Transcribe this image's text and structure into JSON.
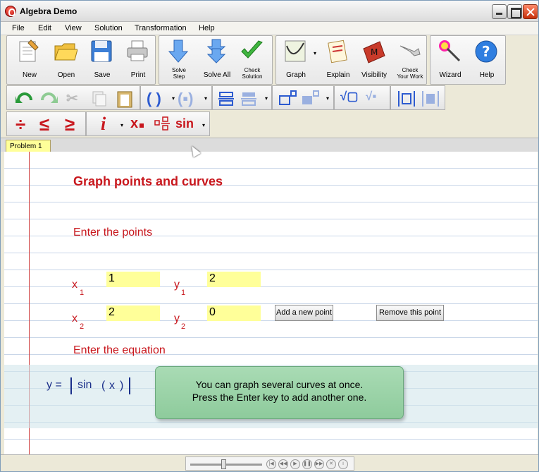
{
  "window": {
    "title": "Algebra Demo"
  },
  "menu": [
    "File",
    "Edit",
    "View",
    "Solution",
    "Transformation",
    "Help"
  ],
  "toolbar": {
    "new": "New",
    "open": "Open",
    "save": "Save",
    "print": "Print",
    "solve_step": "Solve\nStep",
    "solve_all": "Solve All",
    "check_solution": "Check\nSolution",
    "graph": "Graph",
    "explain": "Explain",
    "visibility": "Visibility",
    "check_work": "Check\nYour Work",
    "wizard": "Wizard",
    "help": "Help"
  },
  "format_toolbar": {
    "divide": "÷",
    "less_equal": "≤",
    "greater_equal": "≥",
    "info": "i",
    "subscript_x": "x",
    "sin": "sin"
  },
  "tabs": {
    "problem": "Problem 1"
  },
  "content": {
    "title": "Graph points and curves",
    "points_heading": "Enter the points",
    "equation_heading": "Enter the equation",
    "point1": {
      "x_label": "x",
      "x_sub": "1",
      "x_value": "1",
      "y_label": "y",
      "y_sub": "1",
      "y_value": "2"
    },
    "point2": {
      "x_label": "x",
      "x_sub": "2",
      "x_value": "2",
      "y_label": "y",
      "y_sub": "2",
      "y_value": "0"
    },
    "add_point_button": "Add a new point",
    "remove_point_button": "Remove this point",
    "equation": {
      "lhs": "y =",
      "func": "sin",
      "open_paren": "(",
      "arg": "x",
      "close_paren": ")"
    },
    "tooltip_line1": "You can graph several curves at once.",
    "tooltip_line2": "Press the Enter key to add another one."
  },
  "colors": {
    "accent": "#c8171d",
    "equation": "#1a2f8a",
    "field_bg": "#ffff99",
    "tooltip_bg": "#9dd3a9"
  }
}
